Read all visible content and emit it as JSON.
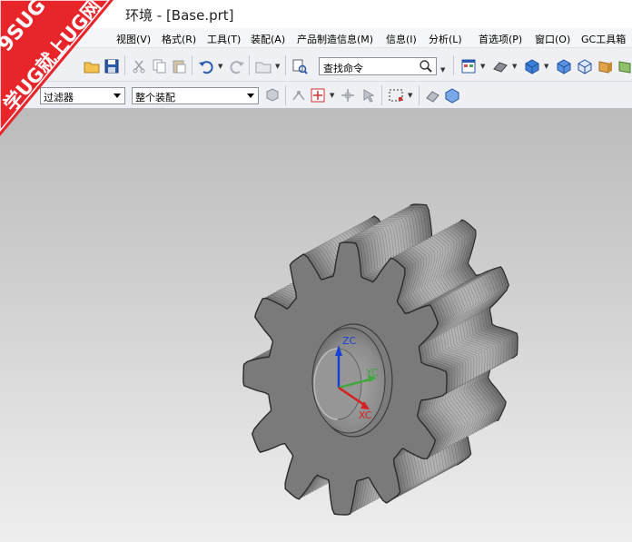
{
  "window": {
    "title": "环境 - [Base.prt]"
  },
  "watermark": {
    "line1": "9SUG",
    "line2": "学UG就上UG网"
  },
  "menu": [
    {
      "label": "视图(V)"
    },
    {
      "label": "格式(R)"
    },
    {
      "label": "工具(T)"
    },
    {
      "label": "装配(A)"
    },
    {
      "label": "产品制造信息(M)"
    },
    {
      "label": "信息(I)"
    },
    {
      "label": "分析(L)"
    },
    {
      "label": "首选项(P)"
    },
    {
      "label": "窗口(O)"
    },
    {
      "label": "GC工具箱"
    }
  ],
  "toolbar": {
    "command_search": {
      "value": "查找命令"
    }
  },
  "selection_bar": {
    "type_filter": {
      "value": "过滤器"
    },
    "scope": {
      "value": "整个装配"
    }
  },
  "viewport": {
    "csys": {
      "z_label": "ZC",
      "y_label": "YC",
      "x_label": "XC"
    },
    "colors": {
      "part": "#7a7a7a",
      "z_axis": "#1a3fd6",
      "y_axis": "#3fa83f",
      "x_axis": "#d62020"
    }
  }
}
